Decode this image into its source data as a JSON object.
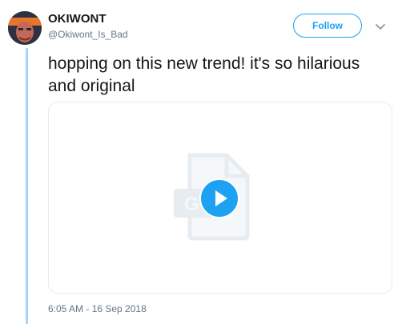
{
  "author": {
    "display_name": "OKIWONT",
    "handle": "@Okiwont_Is_Bad",
    "avatar_icon": "avatar-icon"
  },
  "actions": {
    "follow_label": "Follow",
    "more_icon": "chevron-down-icon"
  },
  "tweet": {
    "text": "hopping on this new trend! it's so hilarious and original",
    "media_type": "gif",
    "timestamp": "6:05 AM - 16 Sep 2018"
  },
  "colors": {
    "accent": "#1da1f2",
    "thread_line": "#a6d4fa",
    "secondary_text": "#657786",
    "primary_text": "#14171a"
  }
}
